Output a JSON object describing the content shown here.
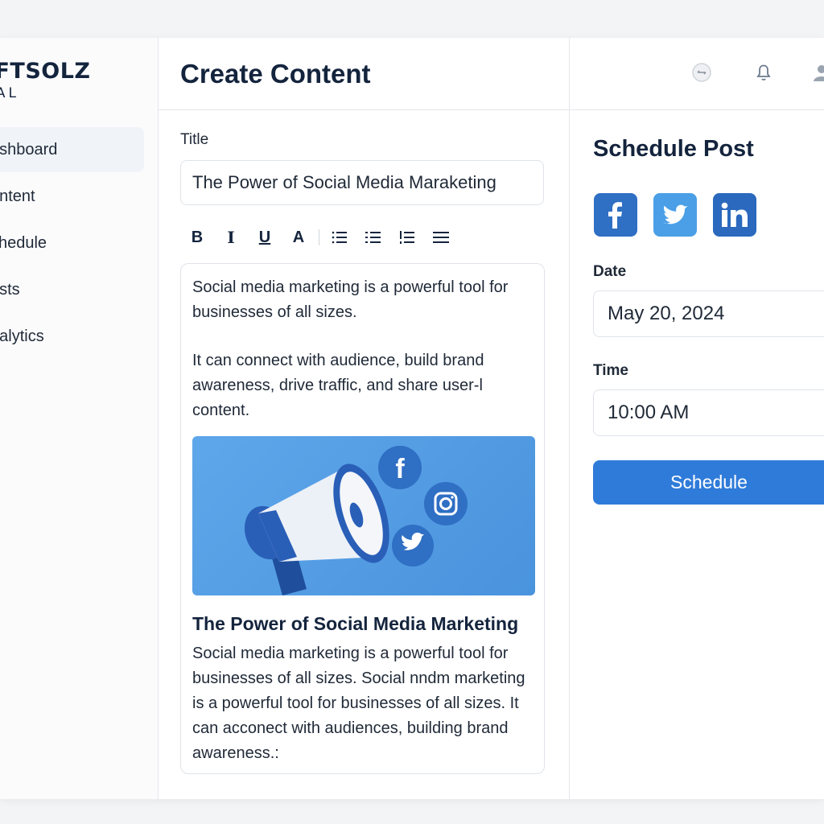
{
  "brand": {
    "line1": "OFTSOLZ",
    "line2": "CIAL"
  },
  "sidebar": {
    "items": [
      {
        "label": "ashboard",
        "active": true
      },
      {
        "label": "ontent"
      },
      {
        "label": "chedule"
      },
      {
        "label": "osts"
      },
      {
        "label": "nalytics"
      }
    ]
  },
  "editor": {
    "page_title": "Create Content",
    "title_label": "Title",
    "title_value": "The Power of Social Media Maraketing",
    "toolbar": {
      "bold": "B",
      "italic": "I",
      "underline": "U",
      "text_color": "A",
      "icons": [
        "bulleted-list-icon",
        "numbered-list-icon",
        "checklist-icon",
        "align-icon"
      ]
    },
    "paragraph1": "Social media marketing is a powerful tool for businesses of all sizes.",
    "paragraph2": "It can connect with audience, build brand awareness, drive traffic, and share user-l content.",
    "preview_title": "The Power of Social Media Marketing",
    "preview_body": "Social media marketing is a powerful tool for businesses of all sizes. Social nndm marketing is a powerful tool for businesses of all sizes. It can acconect with audiences, building brand awareness.:"
  },
  "header_icons": [
    "toggle-icon",
    "bell-icon",
    "user-icon"
  ],
  "schedule": {
    "title": "Schedule Post",
    "networks": [
      "facebook",
      "twitter",
      "linkedin"
    ],
    "date_label": "Date",
    "date_value": "May 20, 2024",
    "time_label": "Time",
    "time_value": "10:00 AM",
    "button_label": "Schedule"
  },
  "colors": {
    "facebook": "#2f6fc4",
    "twitter": "#4a9fe6",
    "linkedin": "#2a69bd",
    "accent": "#2f7bd9",
    "heading": "#14243d"
  }
}
